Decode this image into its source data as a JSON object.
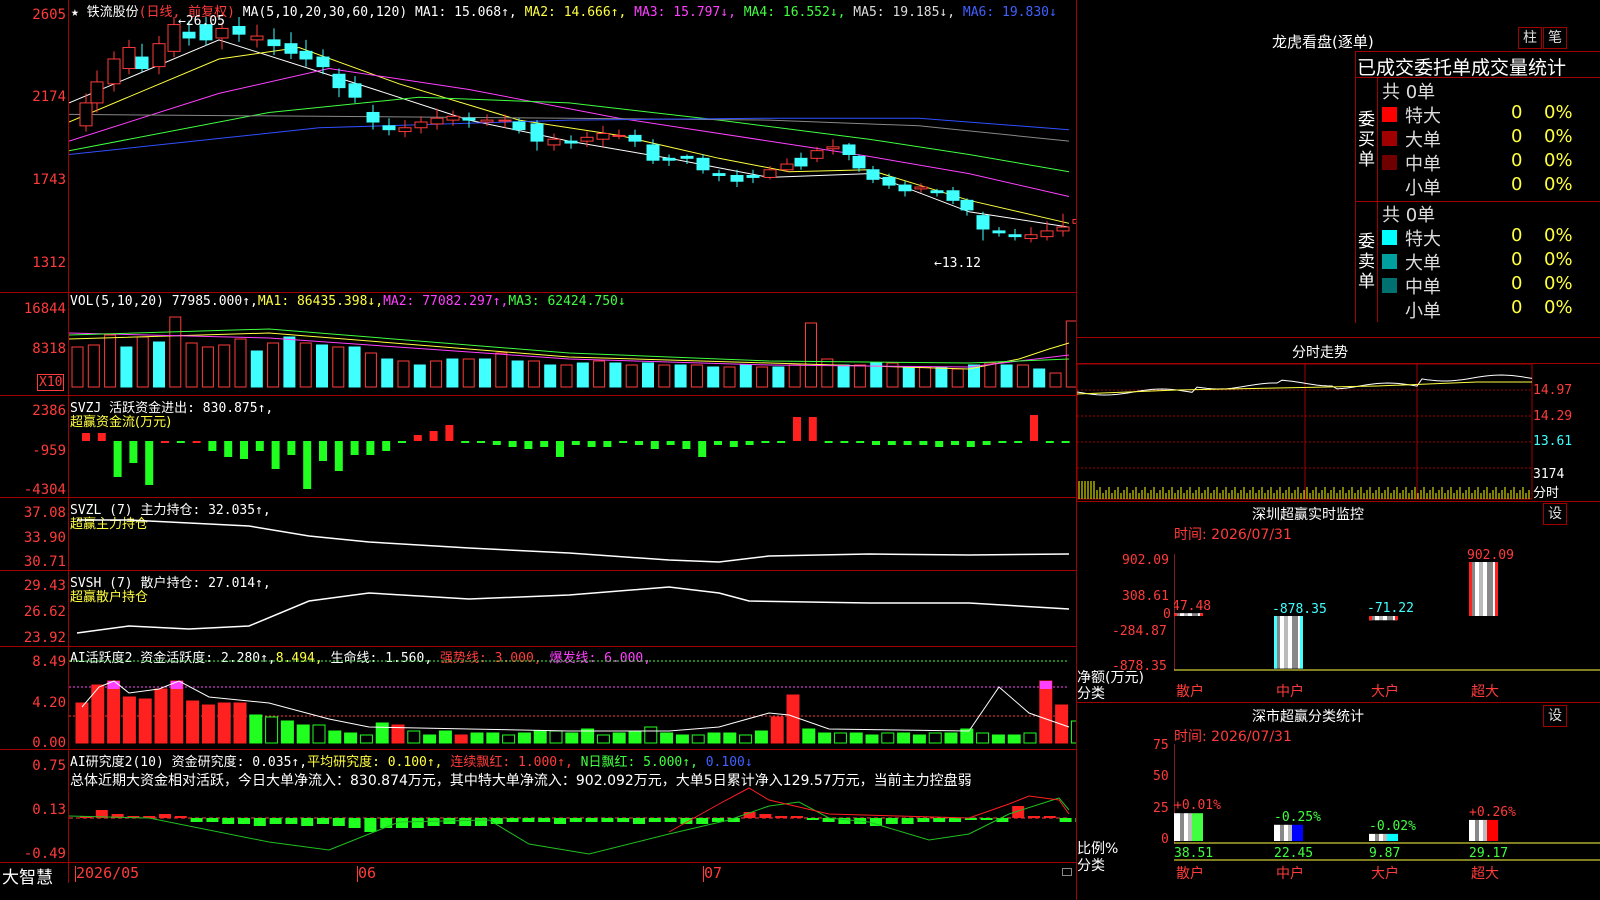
{
  "stock": {
    "name": "★ 铁流股份",
    "mode": "(日线, 前复权)",
    "ma_label": "MA(5,10,20,30,60,120)",
    "ma_values": [
      {
        "label": "MA1: 15.068↑,",
        "color": "#ffffff"
      },
      {
        "label": "MA2: 14.666↑,",
        "color": "#ffff40"
      },
      {
        "label": "MA3: 15.797↓,",
        "color": "#ff40ff"
      },
      {
        "label": "MA4: 16.552↓,",
        "color": "#40ff40"
      },
      {
        "label": "MA5: 19.185↓,",
        "color": "#dddddd"
      },
      {
        "label": "MA6: 19.830↓",
        "color": "#4060ff"
      }
    ],
    "high_mark": "26.05",
    "low_mark": "13.12"
  },
  "price_axis": [
    "2605",
    "2174",
    "1743",
    "1312"
  ],
  "vol": {
    "header": "VOL(5,10,20)",
    "value": "77985.000↑,",
    "ma1": "MA1: 86435.398↓,",
    "ma2": "MA2: 77082.297↑,",
    "ma3": "MA3: 62424.750↓",
    "axis": [
      "16844",
      "8318"
    ],
    "unit": "X10"
  },
  "svzj": {
    "header": "SVZJ  活跃资金进出: 830.875↑,",
    "sub": "超赢资金流(万元)",
    "axis": [
      "2386",
      "-959",
      "-4304"
    ]
  },
  "svzl": {
    "header": "SVZL (7) 主力持仓: 32.035↑,",
    "sub": "超赢主力持仓",
    "axis": [
      "37.08",
      "33.90",
      "30.71"
    ]
  },
  "svsh": {
    "header": "SVSH (7) 散户持仓: 27.014↑,",
    "sub": "超赢散户持仓",
    "axis": [
      "29.43",
      "26.62",
      "23.92"
    ]
  },
  "ai2": {
    "header": "AI活跃度2 资金活跃度: 2.280↑,",
    "v2": "8.494,",
    "life": "生命线: 1.560,",
    "strong": "强势线: 3.000,",
    "burst": "爆发线: 6.000,",
    "axis": [
      "8.49",
      "4.20",
      "0.00"
    ]
  },
  "ai_res": {
    "header": "AI研究度2(10) 资金研究度: 0.035↑,",
    "avg": "平均研究度: 0.100↑,",
    "cont": "连续飘红: 1.000↑,",
    "nday": "N日飘红: 5.000↑,",
    "last": "0.100↓",
    "summary": "总体近期大资金相对活跃，今日大单净流入：830.874万元，其中特大单净流入：902.092万元，大单5日累计净入129.57万元，当前主力控盘弱",
    "axis": [
      "0.75",
      "0.13",
      "-0.49"
    ]
  },
  "bottom": {
    "logo": "大智慧",
    "dates": [
      "2026/05",
      "06",
      "07"
    ]
  },
  "longhu": {
    "title": "龙虎看盘(逐单)",
    "btn_bar": "柱",
    "btn_pen": "笔",
    "tabs_label": "已成交委托单成交量统计",
    "buy": {
      "side": "委买单",
      "count": "共 0单",
      "rows": [
        {
          "name": "特大",
          "n": "0",
          "pct": "0%",
          "color": "#ff0000"
        },
        {
          "name": "大单",
          "n": "0",
          "pct": "0%",
          "color": "#a00000"
        },
        {
          "name": "中单",
          "n": "0",
          "pct": "0%",
          "color": "#700000"
        },
        {
          "name": "小单",
          "n": "0",
          "pct": "0%",
          "color": "#000000"
        }
      ]
    },
    "sell": {
      "side": "委卖单",
      "count": "共 0单",
      "rows": [
        {
          "name": "特大",
          "n": "0",
          "pct": "0%",
          "color": "#00ffff"
        },
        {
          "name": "大单",
          "n": "0",
          "pct": "0%",
          "color": "#00a0a0"
        },
        {
          "name": "中单",
          "n": "0",
          "pct": "0%",
          "color": "#007070"
        },
        {
          "name": "小单",
          "n": "0",
          "pct": "0%",
          "color": "#000000"
        }
      ]
    }
  },
  "fenshi": {
    "title": "分时走势",
    "axis": [
      "14.97",
      "14.29",
      "13.61",
      "3174",
      "分时"
    ]
  },
  "monitor": {
    "title": "深圳超赢实时监控",
    "set": "设",
    "time": "时间: 2026/07/31",
    "axis": [
      "902.09",
      "308.61",
      "0",
      "-284.87",
      "-878.35"
    ],
    "ylabel": "净额(万元)",
    "xlabel": "分类",
    "bars": [
      {
        "cat": "散户",
        "value": 47.48,
        "label": "47.48"
      },
      {
        "cat": "中户",
        "value": -878.35,
        "label": "-878.35"
      },
      {
        "cat": "大户",
        "value": -71.22,
        "label": "-71.22"
      },
      {
        "cat": "超大",
        "value": 902.09,
        "label": "902.09"
      }
    ]
  },
  "stats": {
    "title": "深市超赢分类统计",
    "set": "设",
    "time": "时间: 2026/07/31",
    "axis": [
      "75",
      "50",
      "25",
      "0"
    ],
    "ylabel": "比例%",
    "xlabel": "分类",
    "bars": [
      {
        "cat": "散户",
        "value": 38.51,
        "label": "38.51",
        "delta": "+0.01%",
        "color": "#40ff40"
      },
      {
        "cat": "中户",
        "value": 22.45,
        "label": "22.45",
        "delta": "-0.25%",
        "color": "#0000ff"
      },
      {
        "cat": "大户",
        "value": 9.87,
        "label": "9.87",
        "delta": "-0.02%",
        "color": "#00ffff"
      },
      {
        "cat": "超大",
        "value": 29.17,
        "label": "29.17",
        "delta": "+0.26%",
        "color": "#ff0000"
      }
    ]
  }
}
